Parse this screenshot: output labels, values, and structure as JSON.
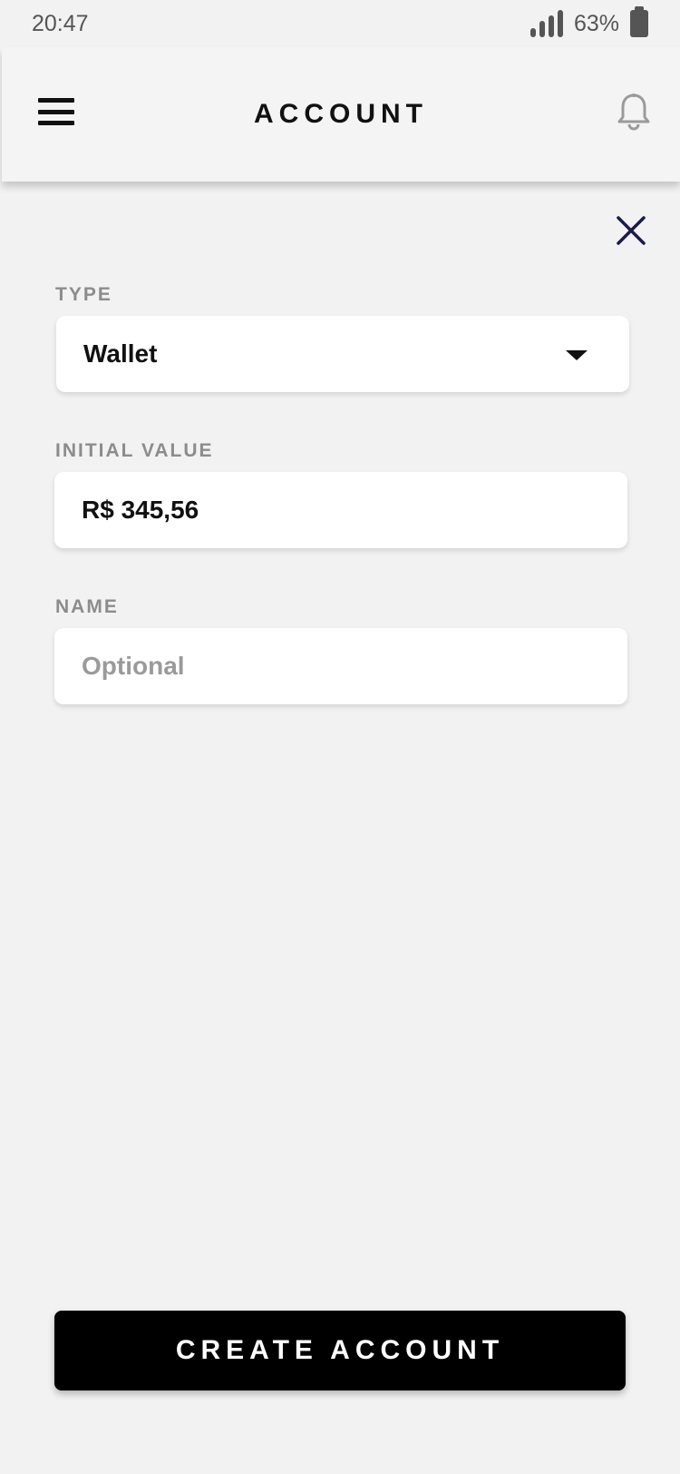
{
  "status_bar": {
    "time": "20:47",
    "battery": "63%"
  },
  "header": {
    "title": "ACCOUNT",
    "menu_icon": "hamburger-menu-icon",
    "notification_icon": "bell-icon"
  },
  "close_icon": "close-icon",
  "form": {
    "type": {
      "label": "TYPE",
      "value": "Wallet"
    },
    "initial_value": {
      "label": "INITIAL VALUE",
      "value": "R$ 345,56"
    },
    "name": {
      "label": "NAME",
      "value": "",
      "placeholder": "Optional"
    }
  },
  "actions": {
    "create_label": "CREATE ACCOUNT"
  },
  "colors": {
    "background": "#f2f2f2",
    "primary": "#000000",
    "close": "#1a1a4e",
    "label": "#8c8c8c"
  }
}
